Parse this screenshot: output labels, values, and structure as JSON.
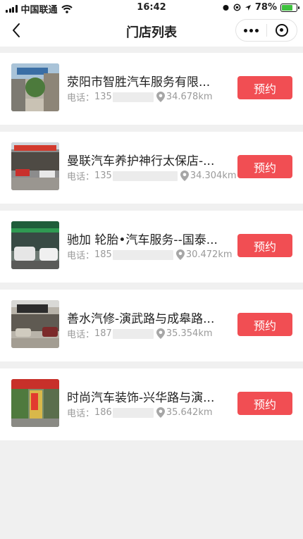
{
  "status_bar": {
    "carrier": "中国联通",
    "time": "16:42",
    "battery": "78%",
    "battery_level": 0.78
  },
  "nav": {
    "title": "门店列表"
  },
  "stores": [
    {
      "name": "荥阳市智胜汽车服务有限...",
      "phone_label": "电话：",
      "phone_prefix": "135",
      "distance": "34.678km",
      "book_label": "预约"
    },
    {
      "name": "曼联汽车养护神行太保店-...",
      "phone_label": "电话：",
      "phone_prefix": "135",
      "distance": "34.304km",
      "book_label": "预约"
    },
    {
      "name": "驰加 轮胎•汽车服务--国泰...",
      "phone_label": "电话：",
      "phone_prefix": "185",
      "distance": "30.472km",
      "book_label": "预约"
    },
    {
      "name": "善水汽修-演武路与成皋路...",
      "phone_label": "电话：",
      "phone_prefix": "187",
      "distance": "35.354km",
      "book_label": "预约"
    },
    {
      "name": "时尚汽车装饰-兴华路与演...",
      "phone_label": "电话：",
      "phone_prefix": "186",
      "distance": "35.642km",
      "book_label": "预约"
    }
  ],
  "colors": {
    "accent": "#f14e53",
    "background": "#f0f0f0"
  }
}
